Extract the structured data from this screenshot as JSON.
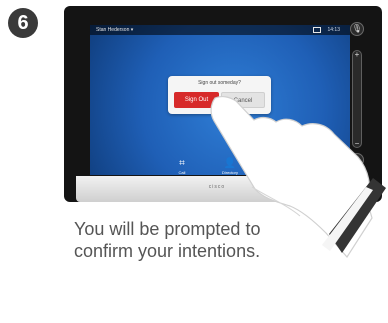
{
  "step_number": "6",
  "device": {
    "brand_text": "cisco",
    "status_bar": {
      "user": "Stan Hederson ▾",
      "time": "14:13"
    },
    "dialog": {
      "title": "Sign out someday?",
      "confirm_label": "Sign Out",
      "cancel_label": "Cancel"
    },
    "bottom_bar": [
      {
        "label": "Call"
      },
      {
        "label": "Directory"
      },
      {
        "label": "Contacts list"
      }
    ],
    "right_rail": {
      "plus": "+",
      "minus": "−"
    }
  },
  "instruction_text": "You will be prompted to confirm your intentions."
}
